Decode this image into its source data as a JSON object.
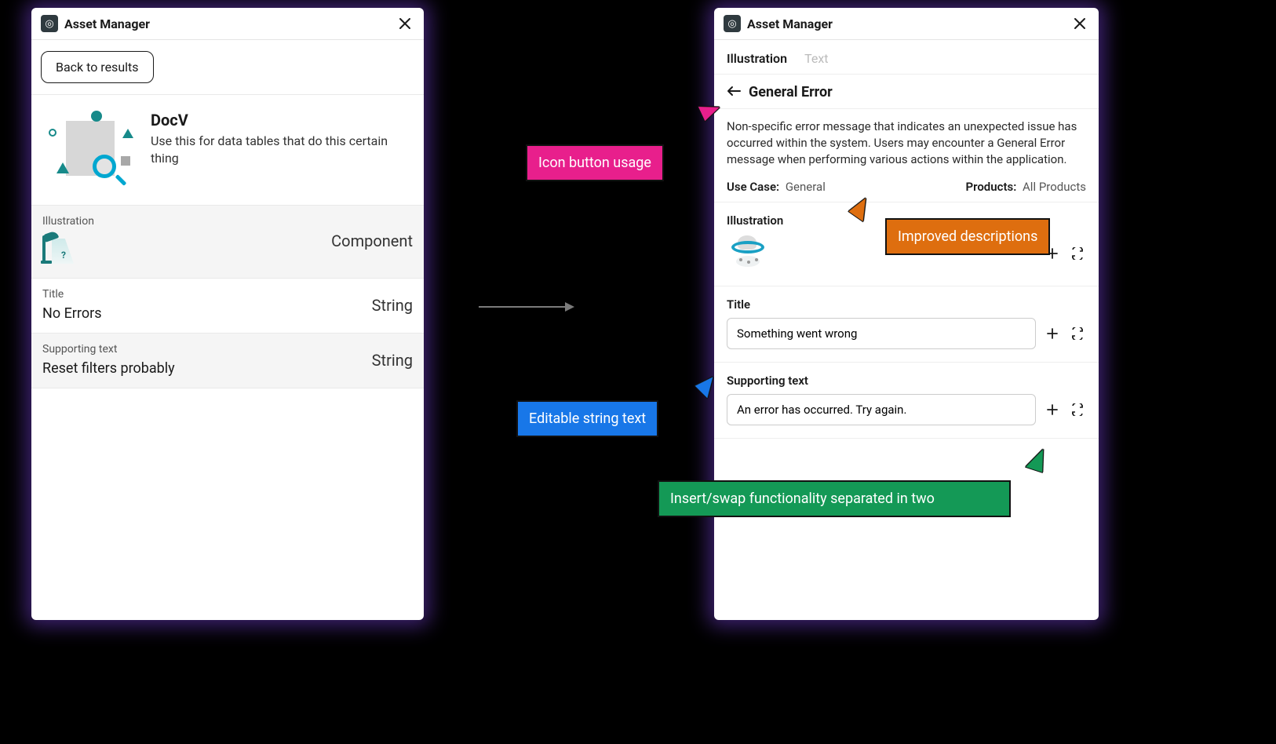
{
  "app": {
    "title": "Asset Manager"
  },
  "left": {
    "back_label": "Back to results",
    "hero": {
      "title": "DocV",
      "desc": "Use this for data tables that do this certain thing"
    },
    "rows": {
      "illustration": {
        "label": "Illustration",
        "type": "Component"
      },
      "title": {
        "label": "Title",
        "value": "No Errors",
        "type": "String"
      },
      "supporting": {
        "label": "Supporting text",
        "value": "Reset filters probably",
        "type": "String"
      }
    }
  },
  "right": {
    "tabs": {
      "illustration": "Illustration",
      "text": "Text"
    },
    "detail": {
      "heading": "General Error",
      "description": "Non-specific error message that indicates an unexpected issue has occurred within the system. Users may encounter a General Error message when performing various actions within the application.",
      "usecase_key": "Use Case:",
      "usecase_val": "General",
      "products_key": "Products:",
      "products_val": "All Products"
    },
    "sections": {
      "illustration": {
        "label": "Illustration"
      },
      "title": {
        "label": "Title",
        "value": "Something went wrong"
      },
      "supporting": {
        "label": "Supporting text",
        "value": "An error has occurred. Try again."
      }
    }
  },
  "annotations": {
    "pink": "Icon button usage",
    "orange": "Improved descriptions",
    "blue": "Editable string text",
    "green": "Insert/swap functionality separated in two"
  }
}
